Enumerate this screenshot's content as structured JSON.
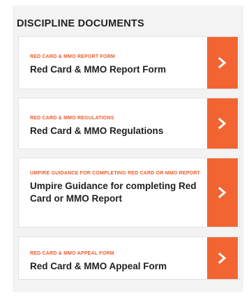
{
  "section": {
    "title": "DISCIPLINE DOCUMENTS"
  },
  "colors": {
    "accent": "#f26532",
    "eyebrow": "#ef5a2b",
    "panel_bg": "#f3f3f3",
    "card_bg": "#ffffff",
    "title_text": "#1f1f1f"
  },
  "documents": [
    {
      "eyebrow": "RED CARD & MMO REPORT FORM",
      "title": "Red Card & MMO Report Form",
      "icon": "chevron-right-icon"
    },
    {
      "eyebrow": "RED CARD & MMO REGULATIONS",
      "title": "Red Card & MMO Regulations",
      "icon": "chevron-right-icon"
    },
    {
      "eyebrow": "UMPIRE GUIDANCE FOR COMPLETING RED CARD OR MMO REPORT",
      "title": "Umpire Guidance for completing Red Card or MMO Report",
      "icon": "chevron-right-icon"
    },
    {
      "eyebrow": "RED CARD & MMO APPEAL FORM",
      "title": "Red Card & MMO Appeal Form",
      "icon": "chevron-right-icon"
    }
  ]
}
